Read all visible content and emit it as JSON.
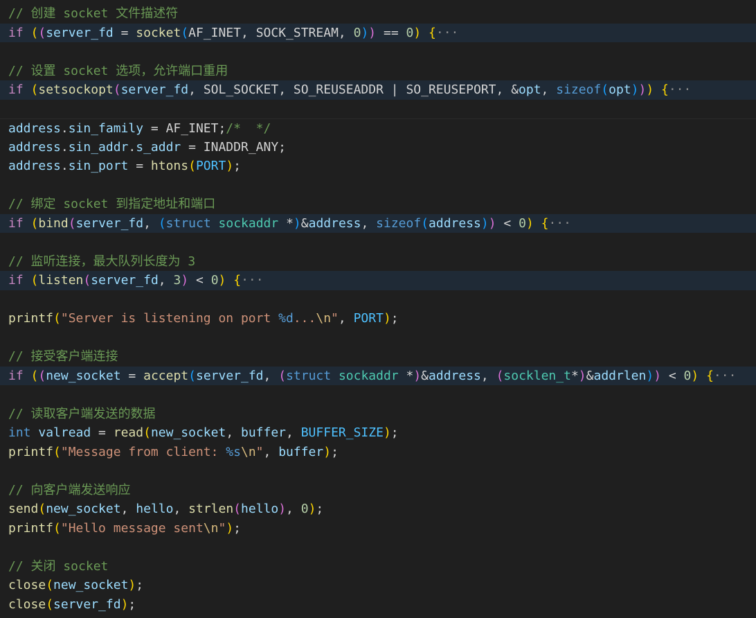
{
  "editor": {
    "lines": [
      {
        "kind": "code",
        "tokens": [
          {
            "t": "// 创建 socket 文件描述符",
            "c": "comment"
          }
        ]
      },
      {
        "kind": "folded",
        "tokens": [
          {
            "t": "if",
            "c": "ctl"
          },
          {
            "t": " ",
            "c": "plain"
          },
          {
            "t": "(",
            "c": "b1"
          },
          {
            "t": "(",
            "c": "b2"
          },
          {
            "t": "server_fd",
            "c": "var"
          },
          {
            "t": " = ",
            "c": "op"
          },
          {
            "t": "socket",
            "c": "fn"
          },
          {
            "t": "(",
            "c": "b3"
          },
          {
            "t": "AF_INET",
            "c": "plain"
          },
          {
            "t": ", ",
            "c": "plain"
          },
          {
            "t": "SOCK_STREAM",
            "c": "plain"
          },
          {
            "t": ", ",
            "c": "plain"
          },
          {
            "t": "0",
            "c": "num"
          },
          {
            "t": ")",
            "c": "b3"
          },
          {
            "t": ")",
            "c": "b2"
          },
          {
            "t": " == ",
            "c": "op"
          },
          {
            "t": "0",
            "c": "num"
          },
          {
            "t": ")",
            "c": "b1"
          },
          {
            "t": " ",
            "c": "plain"
          },
          {
            "t": "{",
            "c": "b1"
          },
          {
            "t": "···",
            "c": "ellipsis"
          }
        ]
      },
      {
        "kind": "blank",
        "tokens": []
      },
      {
        "kind": "code",
        "tokens": [
          {
            "t": "// 设置 socket 选项，允许端口重用",
            "c": "comment"
          }
        ]
      },
      {
        "kind": "folded",
        "tokens": [
          {
            "t": "if",
            "c": "ctl"
          },
          {
            "t": " ",
            "c": "plain"
          },
          {
            "t": "(",
            "c": "b1"
          },
          {
            "t": "setsockopt",
            "c": "fn"
          },
          {
            "t": "(",
            "c": "b2"
          },
          {
            "t": "server_fd",
            "c": "var"
          },
          {
            "t": ", ",
            "c": "plain"
          },
          {
            "t": "SOL_SOCKET",
            "c": "plain"
          },
          {
            "t": ", ",
            "c": "plain"
          },
          {
            "t": "SO_REUSEADDR",
            "c": "plain"
          },
          {
            "t": " | ",
            "c": "op"
          },
          {
            "t": "SO_REUSEPORT",
            "c": "plain"
          },
          {
            "t": ", ",
            "c": "plain"
          },
          {
            "t": "&",
            "c": "op"
          },
          {
            "t": "opt",
            "c": "var"
          },
          {
            "t": ", ",
            "c": "plain"
          },
          {
            "t": "sizeof",
            "c": "kw"
          },
          {
            "t": "(",
            "c": "b3"
          },
          {
            "t": "opt",
            "c": "var"
          },
          {
            "t": ")",
            "c": "b3"
          },
          {
            "t": ")",
            "c": "b2"
          },
          {
            "t": ")",
            "c": "b1"
          },
          {
            "t": " ",
            "c": "plain"
          },
          {
            "t": "{",
            "c": "b1"
          },
          {
            "t": "···",
            "c": "ellipsis"
          }
        ]
      },
      {
        "kind": "blank",
        "tokens": []
      },
      {
        "kind": "sep",
        "tokens": [
          {
            "t": "address",
            "c": "var"
          },
          {
            "t": ".",
            "c": "plain"
          },
          {
            "t": "sin_family",
            "c": "var"
          },
          {
            "t": " = ",
            "c": "op"
          },
          {
            "t": "AF_INET",
            "c": "plain"
          },
          {
            "t": ";",
            "c": "plain"
          },
          {
            "t": "/*  */",
            "c": "comment"
          }
        ]
      },
      {
        "kind": "code",
        "tokens": [
          {
            "t": "address",
            "c": "var"
          },
          {
            "t": ".",
            "c": "plain"
          },
          {
            "t": "sin_addr",
            "c": "var"
          },
          {
            "t": ".",
            "c": "plain"
          },
          {
            "t": "s_addr",
            "c": "var"
          },
          {
            "t": " = ",
            "c": "op"
          },
          {
            "t": "INADDR_ANY",
            "c": "plain"
          },
          {
            "t": ";",
            "c": "plain"
          }
        ]
      },
      {
        "kind": "code",
        "tokens": [
          {
            "t": "address",
            "c": "var"
          },
          {
            "t": ".",
            "c": "plain"
          },
          {
            "t": "sin_port",
            "c": "var"
          },
          {
            "t": " = ",
            "c": "op"
          },
          {
            "t": "htons",
            "c": "fn"
          },
          {
            "t": "(",
            "c": "b1"
          },
          {
            "t": "PORT",
            "c": "const"
          },
          {
            "t": ")",
            "c": "b1"
          },
          {
            "t": ";",
            "c": "plain"
          }
        ]
      },
      {
        "kind": "blank",
        "tokens": []
      },
      {
        "kind": "code",
        "tokens": [
          {
            "t": "// 绑定 socket 到指定地址和端口",
            "c": "comment"
          }
        ]
      },
      {
        "kind": "folded",
        "tokens": [
          {
            "t": "if",
            "c": "ctl"
          },
          {
            "t": " ",
            "c": "plain"
          },
          {
            "t": "(",
            "c": "b1"
          },
          {
            "t": "bind",
            "c": "fn"
          },
          {
            "t": "(",
            "c": "b2"
          },
          {
            "t": "server_fd",
            "c": "var"
          },
          {
            "t": ", ",
            "c": "plain"
          },
          {
            "t": "(",
            "c": "b3"
          },
          {
            "t": "struct",
            "c": "kw"
          },
          {
            "t": " ",
            "c": "plain"
          },
          {
            "t": "sockaddr",
            "c": "type"
          },
          {
            "t": " *",
            "c": "op"
          },
          {
            "t": ")",
            "c": "b3"
          },
          {
            "t": "&",
            "c": "op"
          },
          {
            "t": "address",
            "c": "var"
          },
          {
            "t": ", ",
            "c": "plain"
          },
          {
            "t": "sizeof",
            "c": "kw"
          },
          {
            "t": "(",
            "c": "b3"
          },
          {
            "t": "address",
            "c": "var"
          },
          {
            "t": ")",
            "c": "b3"
          },
          {
            "t": ")",
            "c": "b2"
          },
          {
            "t": " < ",
            "c": "op"
          },
          {
            "t": "0",
            "c": "num"
          },
          {
            "t": ")",
            "c": "b1"
          },
          {
            "t": " ",
            "c": "plain"
          },
          {
            "t": "{",
            "c": "b1"
          },
          {
            "t": "···",
            "c": "ellipsis"
          }
        ]
      },
      {
        "kind": "blank",
        "tokens": []
      },
      {
        "kind": "code",
        "tokens": [
          {
            "t": "// 监听连接，最大队列长度为 3",
            "c": "comment"
          }
        ]
      },
      {
        "kind": "folded",
        "tokens": [
          {
            "t": "if",
            "c": "ctl"
          },
          {
            "t": " ",
            "c": "plain"
          },
          {
            "t": "(",
            "c": "b1"
          },
          {
            "t": "listen",
            "c": "fn"
          },
          {
            "t": "(",
            "c": "b2"
          },
          {
            "t": "server_fd",
            "c": "var"
          },
          {
            "t": ", ",
            "c": "plain"
          },
          {
            "t": "3",
            "c": "num"
          },
          {
            "t": ")",
            "c": "b2"
          },
          {
            "t": " < ",
            "c": "op"
          },
          {
            "t": "0",
            "c": "num"
          },
          {
            "t": ")",
            "c": "b1"
          },
          {
            "t": " ",
            "c": "plain"
          },
          {
            "t": "{",
            "c": "b1"
          },
          {
            "t": "···",
            "c": "ellipsis"
          }
        ]
      },
      {
        "kind": "blank",
        "tokens": []
      },
      {
        "kind": "code",
        "tokens": [
          {
            "t": "printf",
            "c": "fn"
          },
          {
            "t": "(",
            "c": "b1"
          },
          {
            "t": "\"Server is listening on port ",
            "c": "str"
          },
          {
            "t": "%d",
            "c": "kw"
          },
          {
            "t": "...",
            "c": "str"
          },
          {
            "t": "\\n",
            "c": "esc"
          },
          {
            "t": "\"",
            "c": "str"
          },
          {
            "t": ", ",
            "c": "plain"
          },
          {
            "t": "PORT",
            "c": "const"
          },
          {
            "t": ")",
            "c": "b1"
          },
          {
            "t": ";",
            "c": "plain"
          }
        ]
      },
      {
        "kind": "blank",
        "tokens": []
      },
      {
        "kind": "code",
        "tokens": [
          {
            "t": "// 接受客户端连接",
            "c": "comment"
          }
        ]
      },
      {
        "kind": "folded",
        "tokens": [
          {
            "t": "if",
            "c": "ctl"
          },
          {
            "t": " ",
            "c": "plain"
          },
          {
            "t": "(",
            "c": "b1"
          },
          {
            "t": "(",
            "c": "b2"
          },
          {
            "t": "new_socket",
            "c": "var"
          },
          {
            "t": " = ",
            "c": "op"
          },
          {
            "t": "accept",
            "c": "fn"
          },
          {
            "t": "(",
            "c": "b3"
          },
          {
            "t": "server_fd",
            "c": "var"
          },
          {
            "t": ", ",
            "c": "plain"
          },
          {
            "t": "(",
            "c": "b2"
          },
          {
            "t": "struct",
            "c": "kw"
          },
          {
            "t": " ",
            "c": "plain"
          },
          {
            "t": "sockaddr",
            "c": "type"
          },
          {
            "t": " *",
            "c": "op"
          },
          {
            "t": ")",
            "c": "b2"
          },
          {
            "t": "&",
            "c": "op"
          },
          {
            "t": "address",
            "c": "var"
          },
          {
            "t": ", ",
            "c": "plain"
          },
          {
            "t": "(",
            "c": "b2"
          },
          {
            "t": "socklen_t",
            "c": "type"
          },
          {
            "t": "*",
            "c": "op"
          },
          {
            "t": ")",
            "c": "b2"
          },
          {
            "t": "&",
            "c": "op"
          },
          {
            "t": "addrlen",
            "c": "var"
          },
          {
            "t": ")",
            "c": "b3"
          },
          {
            "t": ")",
            "c": "b2"
          },
          {
            "t": " < ",
            "c": "op"
          },
          {
            "t": "0",
            "c": "num"
          },
          {
            "t": ")",
            "c": "b1"
          },
          {
            "t": " ",
            "c": "plain"
          },
          {
            "t": "{",
            "c": "b1"
          },
          {
            "t": "···",
            "c": "ellipsis"
          }
        ]
      },
      {
        "kind": "blank",
        "tokens": []
      },
      {
        "kind": "code",
        "tokens": [
          {
            "t": "// 读取客户端发送的数据",
            "c": "comment"
          }
        ]
      },
      {
        "kind": "code",
        "tokens": [
          {
            "t": "int",
            "c": "kw"
          },
          {
            "t": " ",
            "c": "plain"
          },
          {
            "t": "valread",
            "c": "var"
          },
          {
            "t": " = ",
            "c": "op"
          },
          {
            "t": "read",
            "c": "fn"
          },
          {
            "t": "(",
            "c": "b1"
          },
          {
            "t": "new_socket",
            "c": "var"
          },
          {
            "t": ", ",
            "c": "plain"
          },
          {
            "t": "buffer",
            "c": "var"
          },
          {
            "t": ", ",
            "c": "plain"
          },
          {
            "t": "BUFFER_SIZE",
            "c": "const"
          },
          {
            "t": ")",
            "c": "b1"
          },
          {
            "t": ";",
            "c": "plain"
          }
        ]
      },
      {
        "kind": "code",
        "tokens": [
          {
            "t": "printf",
            "c": "fn"
          },
          {
            "t": "(",
            "c": "b1"
          },
          {
            "t": "\"Message from client: ",
            "c": "str"
          },
          {
            "t": "%s",
            "c": "kw"
          },
          {
            "t": "\\n",
            "c": "esc"
          },
          {
            "t": "\"",
            "c": "str"
          },
          {
            "t": ", ",
            "c": "plain"
          },
          {
            "t": "buffer",
            "c": "var"
          },
          {
            "t": ")",
            "c": "b1"
          },
          {
            "t": ";",
            "c": "plain"
          }
        ]
      },
      {
        "kind": "blank",
        "tokens": []
      },
      {
        "kind": "code",
        "tokens": [
          {
            "t": "// 向客户端发送响应",
            "c": "comment"
          }
        ]
      },
      {
        "kind": "code",
        "tokens": [
          {
            "t": "send",
            "c": "fn"
          },
          {
            "t": "(",
            "c": "b1"
          },
          {
            "t": "new_socket",
            "c": "var"
          },
          {
            "t": ", ",
            "c": "plain"
          },
          {
            "t": "hello",
            "c": "var"
          },
          {
            "t": ", ",
            "c": "plain"
          },
          {
            "t": "strlen",
            "c": "fn"
          },
          {
            "t": "(",
            "c": "b2"
          },
          {
            "t": "hello",
            "c": "var"
          },
          {
            "t": ")",
            "c": "b2"
          },
          {
            "t": ", ",
            "c": "plain"
          },
          {
            "t": "0",
            "c": "num"
          },
          {
            "t": ")",
            "c": "b1"
          },
          {
            "t": ";",
            "c": "plain"
          }
        ]
      },
      {
        "kind": "code",
        "tokens": [
          {
            "t": "printf",
            "c": "fn"
          },
          {
            "t": "(",
            "c": "b1"
          },
          {
            "t": "\"Hello message sent",
            "c": "str"
          },
          {
            "t": "\\n",
            "c": "esc"
          },
          {
            "t": "\"",
            "c": "str"
          },
          {
            "t": ")",
            "c": "b1"
          },
          {
            "t": ";",
            "c": "plain"
          }
        ]
      },
      {
        "kind": "blank",
        "tokens": []
      },
      {
        "kind": "code",
        "tokens": [
          {
            "t": "// 关闭 socket",
            "c": "comment"
          }
        ]
      },
      {
        "kind": "code",
        "tokens": [
          {
            "t": "close",
            "c": "fn"
          },
          {
            "t": "(",
            "c": "b1"
          },
          {
            "t": "new_socket",
            "c": "var"
          },
          {
            "t": ")",
            "c": "b1"
          },
          {
            "t": ";",
            "c": "plain"
          }
        ]
      },
      {
        "kind": "code",
        "tokens": [
          {
            "t": "close",
            "c": "fn"
          },
          {
            "t": "(",
            "c": "b1"
          },
          {
            "t": "server_fd",
            "c": "var"
          },
          {
            "t": ")",
            "c": "b1"
          },
          {
            "t": ";",
            "c": "plain"
          }
        ]
      }
    ]
  }
}
